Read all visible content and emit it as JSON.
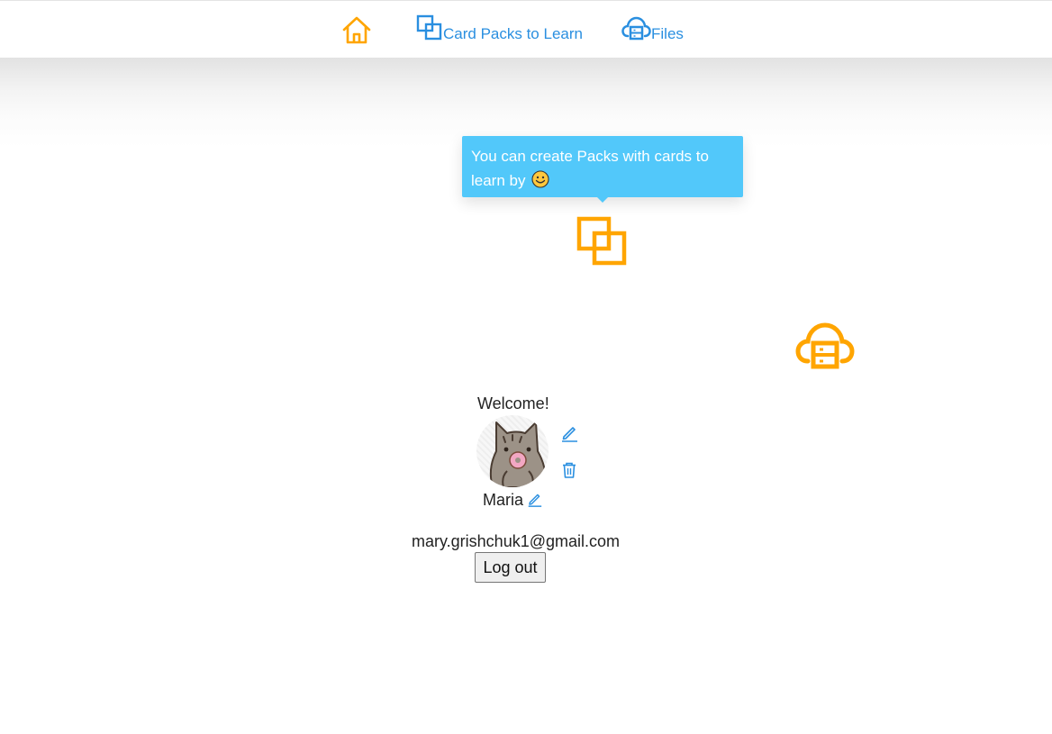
{
  "nav": {
    "home_icon": "home-icon",
    "packs": {
      "label": "Card Packs to Learn",
      "icon": "card-packs-icon"
    },
    "files": {
      "label": "Files",
      "icon": "cloud-files-icon"
    }
  },
  "tooltip": {
    "text": "You can create Packs with cards to learn by",
    "emoji": "smiley-icon"
  },
  "profile": {
    "welcome": "Welcome!",
    "name": "Maria",
    "email": "mary.grishchuk1@gmail.com",
    "logout_label": "Log out",
    "avatar_icon": "pusheen-cat-avatar"
  },
  "colors": {
    "accent_orange": "#ffa500",
    "link_blue": "#2a8fe0",
    "tooltip_bg": "#52c8fa"
  }
}
